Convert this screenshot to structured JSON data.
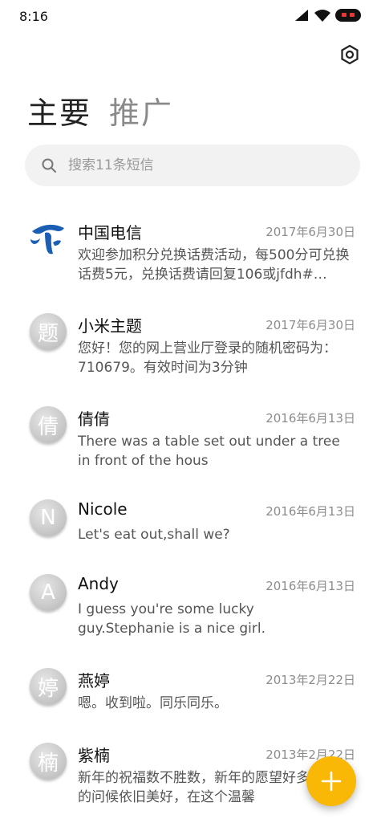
{
  "status_bar": {
    "time": "8:16"
  },
  "header": {
    "tabs": [
      {
        "label": "主要",
        "active": true
      },
      {
        "label": "推广",
        "active": false
      }
    ]
  },
  "search": {
    "placeholder": "搜索11条短信"
  },
  "conversations": [
    {
      "avatar": "logo",
      "name": "中国电信",
      "date": "2017年6月30日",
      "preview": "欢迎参加积分兑换话费活动，每500分可兑换话费5元，兑换话费请回复106或jfdh#…"
    },
    {
      "avatar": "题",
      "name": "小米主题",
      "date": "2017年6月30日",
      "preview": "您好！您的网上营业厅登录的随机密码为：710679。有效时间为3分钟"
    },
    {
      "avatar": "倩",
      "name": "倩倩",
      "date": "2016年6月13日",
      "preview": "There was a table set out under a tree in front of the hous"
    },
    {
      "avatar": "N",
      "name": "Nicole",
      "date": "2016年6月13日",
      "preview": "Let's eat out,shall we?"
    },
    {
      "avatar": "A",
      "name": "Andy",
      "date": "2016年6月13日",
      "preview": "I guess you're some lucky guy.Stephanie is a nice girl."
    },
    {
      "avatar": "婷",
      "name": "燕婷",
      "date": "2013年2月22日",
      "preview": "嗯。收到啦。同乐同乐。"
    },
    {
      "avatar": "楠",
      "name": "紫楠",
      "date": "2013年2月22日",
      "preview": "新年的祝福数不胜数，新年的愿望好多，新年的问候依旧美好，在这个温馨"
    }
  ],
  "colors": {
    "fab": "#f9b806",
    "brand_blue": "#1a5fb4"
  },
  "icons": {
    "settings": "settings-icon",
    "search": "search-icon",
    "compose": "plus-icon"
  }
}
